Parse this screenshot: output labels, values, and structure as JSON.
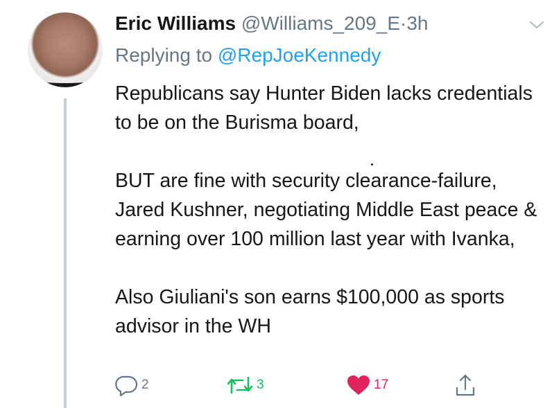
{
  "tweet": {
    "author_name": "Eric Williams",
    "handle": "@Williams_209_E",
    "separator": "·",
    "time": "3h",
    "replying_prefix": "Replying to",
    "replying_mention": "@RepJoeKennedy",
    "paragraphs": [
      "Republicans say Hunter Biden lacks credentials to be on the Burisma board,",
      "BUT are fine with security clearance-failure, Jared Kushner, negotiating Middle East peace & earning over 100 million last year with Ivanka,",
      "Also Giuliani's son earns $100,000 as sports advisor in the WH"
    ]
  },
  "actions": {
    "reply_count": "2",
    "retweet_count": "3",
    "like_count": "17"
  },
  "colors": {
    "text": "#14171a",
    "muted": "#657786",
    "link": "#1da1f2",
    "retweet": "#17bf63",
    "like": "#e0245e",
    "thread_line": "#c4cfd6"
  },
  "icons": {
    "menu": "chevron-down-icon",
    "reply": "reply-bubble-icon",
    "retweet": "retweet-icon",
    "like": "heart-icon",
    "share": "share-icon"
  }
}
